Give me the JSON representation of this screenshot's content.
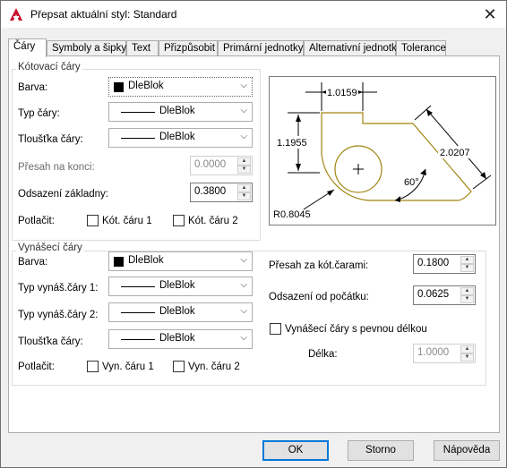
{
  "window": {
    "title": "Přepsat aktuální styl: Standard",
    "close_glyph": "✕"
  },
  "tabs": [
    {
      "label": "Čáry"
    },
    {
      "label": "Symboly a šipky"
    },
    {
      "label": "Text"
    },
    {
      "label": "Přizpůsobit"
    },
    {
      "label": "Primární jednotky"
    },
    {
      "label": "Alternativní jednotky"
    },
    {
      "label": "Tolerance"
    }
  ],
  "dim_lines": {
    "title": "Kótovací čáry",
    "color_label": "Barva:",
    "color_value": "DleBlok",
    "linetype_label": "Typ čáry:",
    "linetype_value": "DleBlok",
    "lineweight_label": "Tloušťka čáry:",
    "lineweight_value": "DleBlok",
    "extend_label": "Přesah na konci:",
    "extend_value": "0.0000",
    "baseline_label": "Odsazení základny:",
    "baseline_value": "0.3800",
    "suppress_label": "Potlačit:",
    "suppress_1": "Kót. čáru 1",
    "suppress_2": "Kót. čáru 2"
  },
  "ext_lines": {
    "title": "Vynášecí čáry",
    "color_label": "Barva:",
    "color_value": "DleBlok",
    "linetype1_label": "Typ vynáš.čáry 1:",
    "linetype1_value": "DleBlok",
    "linetype2_label": "Typ vynáš.čáry 2:",
    "linetype2_value": "DleBlok",
    "lineweight_label": "Tloušťka čáry:",
    "lineweight_value": "DleBlok",
    "suppress_label": "Potlačit:",
    "suppress_1": "Vyn. čáru 1",
    "suppress_2": "Vyn. čáru 2",
    "extend_label": "Přesah za kót.čarami:",
    "extend_value": "0.1800",
    "offset_label": "Odsazení od počátku:",
    "offset_value": "0.0625",
    "fixed_label": "Vynášecí čáry s pevnou délkou",
    "length_label": "Délka:",
    "length_value": "1.0000"
  },
  "preview": {
    "dim_top": "1.0159",
    "dim_left": "1.1955",
    "dim_right": "2.0207",
    "angle": "60°",
    "radius": "R0.8045"
  },
  "buttons": {
    "ok": "OK",
    "cancel": "Storno",
    "help": "Nápověda"
  },
  "colors": {
    "shape": "#a0840f",
    "accent": "#0078d7",
    "app_icon": "#c8102e"
  }
}
